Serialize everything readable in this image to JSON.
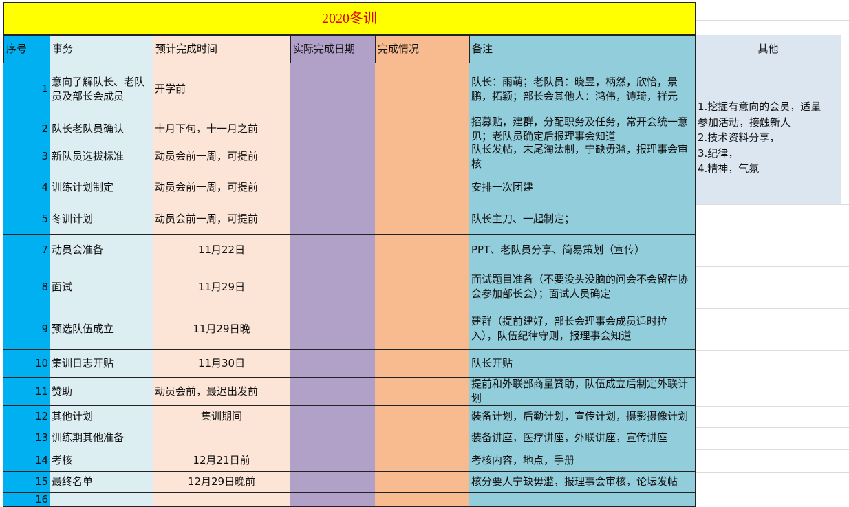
{
  "sheet": {
    "title": "2020冬训",
    "headers": {
      "seq": "序号",
      "task": "事务",
      "planned": "预计完成时间",
      "actual": "实际完成日期",
      "status": "完成情况",
      "note": "备注",
      "other": "其他"
    },
    "other_items": [
      "1.挖掘有意向的会员，适量",
      "参加活动，接触新人",
      "2.技术资料分享，",
      "3.纪律，",
      "4.精神，气氛"
    ],
    "rows": [
      {
        "seq": "1",
        "task": "意向了解队长、老队员及部长会成员",
        "planned": "开学前",
        "note": "队长：雨萌；老队员：晓昱，柄然，欣怡，景鹏，拓颖；部长会其他人：鸿伟，诗琦，祥元"
      },
      {
        "seq": "2",
        "task": "队长老队员确认",
        "planned": "十月下旬，十一月之前",
        "note": "招募贴，建群，分配职务及任务，常开会统一意见；老队员确定后报理事会知道"
      },
      {
        "seq": "3",
        "task": "新队员选拔标准",
        "planned": "动员会前一周，可提前",
        "note": "队长发帖，末尾淘汰制，宁缺毋滥，报理事会审核"
      },
      {
        "seq": "4",
        "task": "训练计划制定",
        "planned": "动员会前一周，可提前",
        "note": "安排一次团建"
      },
      {
        "seq": "5",
        "task": "冬训计划",
        "planned": "动员会前一周，可提前",
        "note": "队长主刀、一起制定；"
      },
      {
        "seq": "7",
        "task": "动员会准备",
        "planned": "11月22日",
        "note": "PPT、老队员分享、简易策划（宣传）"
      },
      {
        "seq": "8",
        "task": "面试",
        "planned": "11月29日",
        "note": "面试题目准备（不要没头没脑的问会不会留在协会参加部长会）；面试人员确定"
      },
      {
        "seq": "9",
        "task": "预选队伍成立",
        "planned": "11月29日晚",
        "note": "建群（提前建好，部长会理事会成员适时拉入），队伍纪律守则，报理事会知道"
      },
      {
        "seq": "10",
        "task": "集训日志开贴",
        "planned": "11月30日",
        "note": "队长开贴"
      },
      {
        "seq": "11",
        "task": "赞助",
        "planned": "动员会前，最迟出发前",
        "note": "提前和外联部商量赞助，队伍成立后制定外联计划"
      },
      {
        "seq": "12",
        "task": "其他计划",
        "planned": "集训期间",
        "note": "装备计划，后勤计划，宣传计划，摄影摄像计划"
      },
      {
        "seq": "13",
        "task": "训练期其他准备",
        "planned": "",
        "note": "装备讲座，医疗讲座，外联讲座，宣传讲座"
      },
      {
        "seq": "14",
        "task": "考核",
        "planned": "12月21日前",
        "note": "考核内容，地点，手册"
      },
      {
        "seq": "15",
        "task": "最终名单",
        "planned": "12月29日晚前",
        "note": "核分要人宁缺毋滥，报理事会审核，论坛发帖"
      },
      {
        "seq": "16",
        "task": "",
        "planned": "",
        "note": ""
      }
    ],
    "colors": {
      "title_bg": "#ffff00",
      "title_text": "#e00000",
      "seq": "#00b0f0",
      "task": "#ddeef3",
      "planned": "#fce4d6",
      "actual": "#b1a0c7",
      "status": "#f8bb8f",
      "note": "#92cddc",
      "other": "#dce6f1"
    }
  }
}
